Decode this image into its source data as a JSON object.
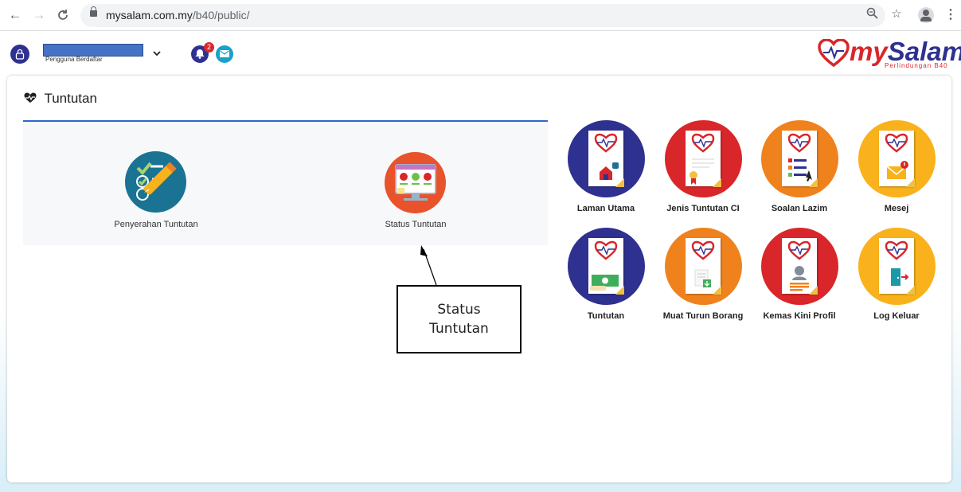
{
  "browser": {
    "back": "←",
    "forward": "→",
    "reload": "C",
    "url_host": "mysalam.com.my",
    "url_path": "/b40/public/",
    "zoom_icon": "zoom-icon",
    "star_icon": "star-icon"
  },
  "header": {
    "user_subtitle": "Pengguna Berdaftar",
    "notification_count": "2",
    "logo_my": "my",
    "logo_salam": "Salam",
    "logo_tagline": "Perlindungan B40"
  },
  "section": {
    "title": "Tuntutan"
  },
  "claims": [
    {
      "label": "Penyerahan Tuntutan",
      "icon": "checklist-pencil-icon"
    },
    {
      "label": "Status Tuntutan",
      "icon": "monitor-status-icon"
    }
  ],
  "annotation": {
    "text": "Status Tuntutan"
  },
  "menu": [
    {
      "label": "Laman Utama",
      "color": "#2e3190",
      "icon": "home-doc-icon"
    },
    {
      "label": "Jenis Tuntutan CI",
      "color": "#d9262a",
      "icon": "certificate-doc-icon"
    },
    {
      "label": "Soalan Lazim",
      "color": "#f0821e",
      "icon": "faq-doc-icon"
    },
    {
      "label": "Mesej",
      "color": "#f9b21b",
      "icon": "mail-doc-icon"
    },
    {
      "label": "Tuntutan",
      "color": "#2e3190",
      "icon": "money-doc-icon"
    },
    {
      "label": "Muat Turun Borang",
      "color": "#f0821e",
      "icon": "download-doc-icon"
    },
    {
      "label": "Kemas Kini Profil",
      "color": "#d9262a",
      "icon": "profile-doc-icon"
    },
    {
      "label": "Log Keluar",
      "color": "#f9b21b",
      "icon": "logout-doc-icon"
    }
  ]
}
